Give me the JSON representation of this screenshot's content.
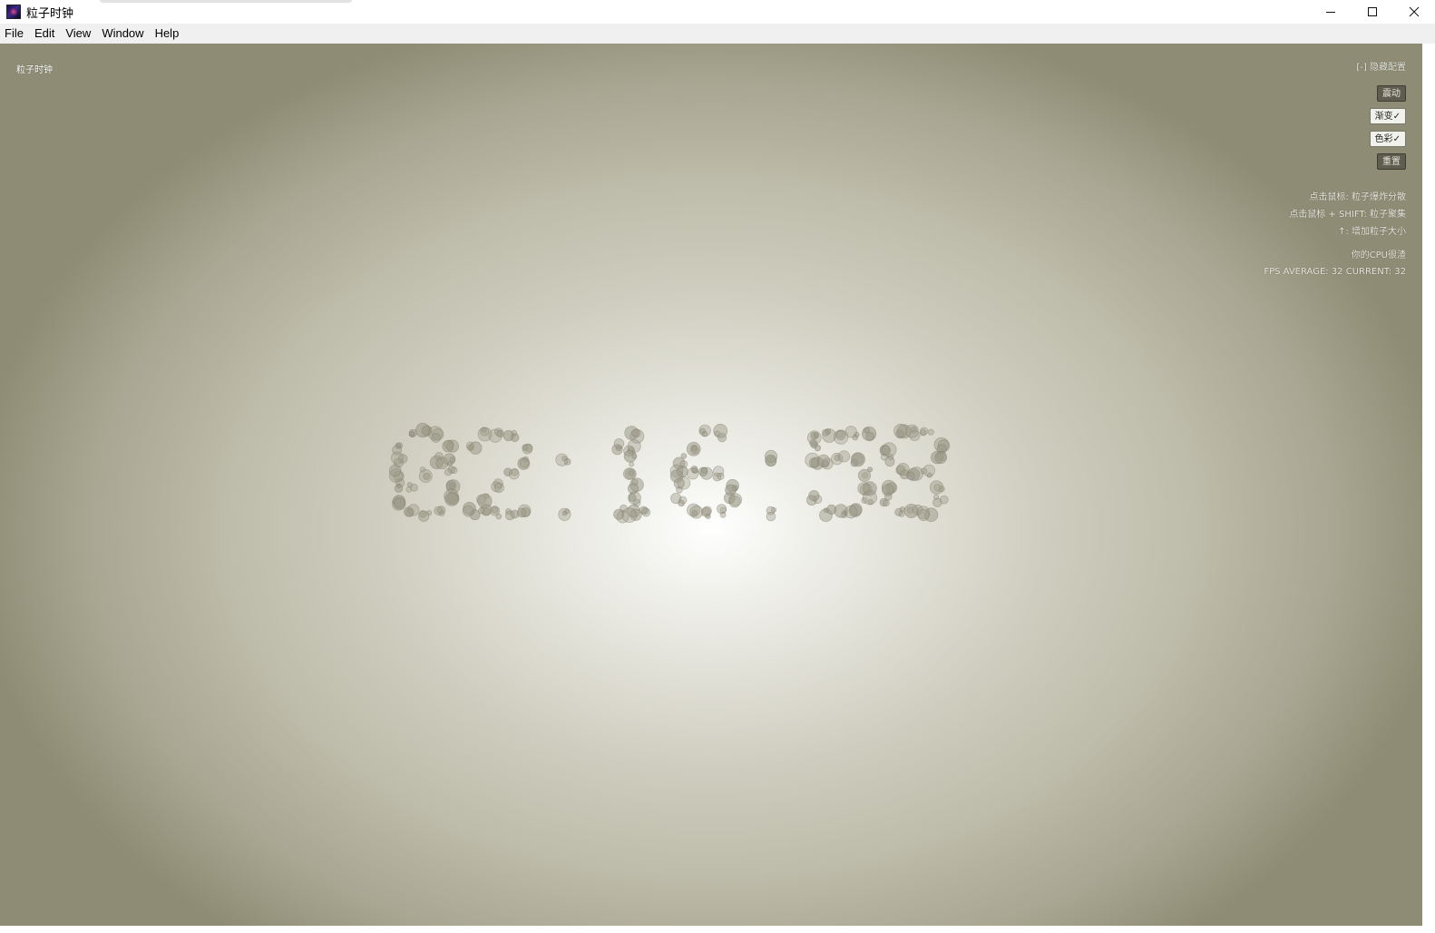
{
  "window": {
    "title": "粒子时钟",
    "controls": {
      "minimize": "minimize-icon",
      "maximize": "maximize-icon",
      "close": "close-icon"
    }
  },
  "menu": {
    "items": [
      "File",
      "Edit",
      "View",
      "Window",
      "Help"
    ]
  },
  "canvas": {
    "title": "粒子时钟",
    "config": {
      "hide_label": "[-] 隐藏配置",
      "buttons": [
        {
          "label": "震动",
          "state": "off"
        },
        {
          "label": "渐变✓",
          "state": "on"
        },
        {
          "label": "色彩✓",
          "state": "on"
        },
        {
          "label": "重置",
          "state": "off"
        }
      ],
      "hints": [
        "点击鼠标: 粒子爆炸分散",
        "点击鼠标 + SHIFT: 粒子聚集",
        "↑: 增加粒子大小"
      ],
      "perf": {
        "label": "你的CPU很渣",
        "fps": "FPS AVERAGE: 32 CURRENT: 32"
      }
    },
    "clock": {
      "time": "02:16:58",
      "particle_color": "#9a9886"
    }
  }
}
